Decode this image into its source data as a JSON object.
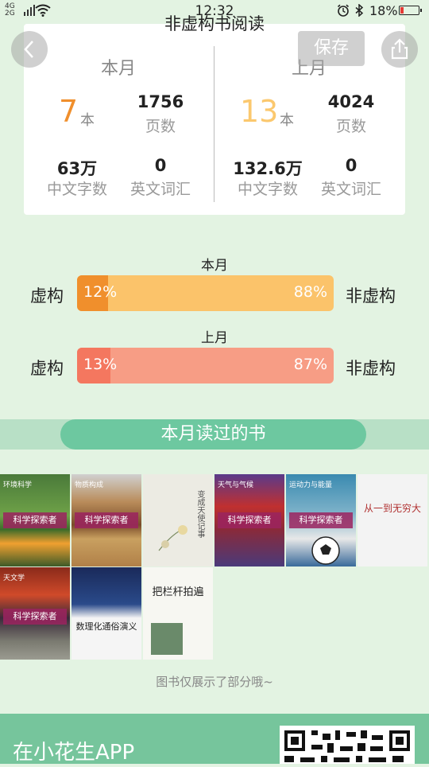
{
  "status_bar": {
    "network": [
      "4G",
      "2G"
    ],
    "time": "12:32",
    "battery": "18%"
  },
  "header": {
    "title": "非虚构书阅读",
    "save_label": "保存",
    "back_icon": "chevron-left-icon",
    "share_icon": "share-icon"
  },
  "stats": {
    "this_month": {
      "title": "本月",
      "books": "7",
      "books_unit": "本",
      "pages": "1756",
      "pages_label": "页数",
      "chinese_chars": "63万",
      "chinese_label": "中文字数",
      "english_words": "0",
      "english_label": "英文词汇"
    },
    "last_month": {
      "title": "上月",
      "books": "13",
      "books_unit": "本",
      "pages": "4024",
      "pages_label": "页数",
      "chinese_chars": "132.6万",
      "chinese_label": "中文字数",
      "english_words": "0",
      "english_label": "英文词汇"
    }
  },
  "ratio": {
    "left_label": "虚构",
    "right_label": "非虚构",
    "this_month": {
      "title": "本月",
      "fiction_pct": "12%",
      "nonfiction_pct": "88%",
      "fiction_fraction": 0.12
    },
    "last_month": {
      "title": "上月",
      "fiction_pct": "13%",
      "nonfiction_pct": "87%",
      "fiction_fraction": 0.13
    }
  },
  "books": {
    "section_title": "本月读过的书",
    "covers": [
      {
        "series": "科学探索者",
        "subtitle": "环境科学"
      },
      {
        "series": "科学探索者",
        "subtitle": "物质构成"
      },
      {
        "series": "",
        "subtitle": "变成天使记事"
      },
      {
        "series": "科学探索者",
        "subtitle": "天气与气候"
      },
      {
        "series": "科学探索者",
        "subtitle": "运动力与能量"
      },
      {
        "series": "",
        "subtitle": "从一到无穷大"
      },
      {
        "series": "科学探索者",
        "subtitle": "天文学"
      },
      {
        "series": "",
        "subtitle": "数理化通俗演义"
      },
      {
        "series": "",
        "subtitle": "把栏杆拍遍"
      }
    ],
    "hint": "图书仅展示了部分哦~"
  },
  "footer": {
    "text": "在小花生APP"
  },
  "colors": {
    "background": "#e3f3e2",
    "orange_fiction": "#f08f2c",
    "orange_nonfiction": "#fbc36a",
    "salmon_fiction": "#f4775f",
    "salmon_nonfiction": "#f79d85",
    "accent_green": "#6dc8a0"
  }
}
